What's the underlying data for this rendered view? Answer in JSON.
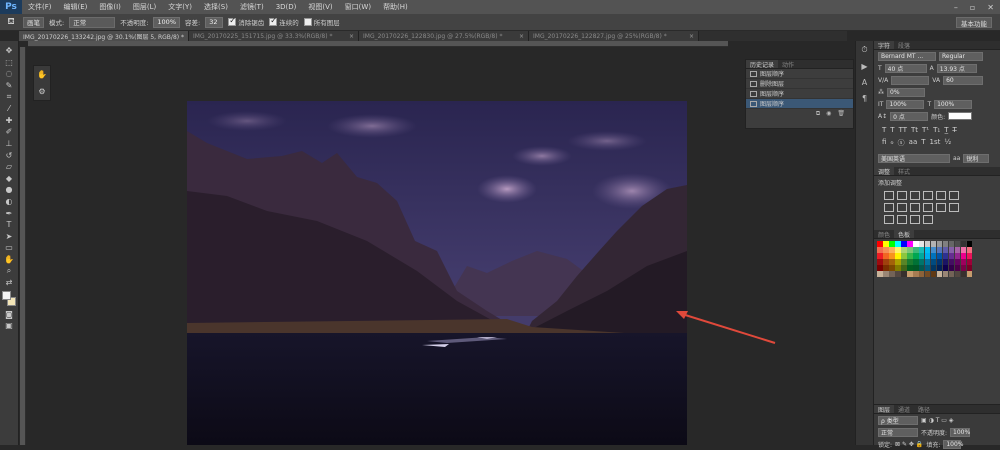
{
  "app": {
    "logo": "Ps"
  },
  "menu": [
    "文件(F)",
    "编辑(E)",
    "图像(I)",
    "图层(L)",
    "文字(Y)",
    "选择(S)",
    "滤镜(T)",
    "3D(D)",
    "视图(V)",
    "窗口(W)",
    "帮助(H)"
  ],
  "options": {
    "mode_value": "正常",
    "mode_label": "模式:",
    "preset_value": "画笔",
    "opacity_label": "不透明度:",
    "opacity_value": "100%",
    "tolerance_label": "容差:",
    "tolerance_value": "32",
    "antialias_label": "消除锯齿",
    "contiguous_label": "连续的",
    "all_layers_label": "所有图层",
    "workspace": "基本功能"
  },
  "doc_tabs": [
    {
      "label": "IMG_20170226_133242.jpg @ 30.1%(图层 5, RGB/8) *"
    },
    {
      "label": "IMG_20170225_151715.jpg @ 33.3%(RGB/8) *"
    },
    {
      "label": "IMG_20170226_122830.jpg @ 27.5%(RGB/8) *"
    },
    {
      "label": "IMG_20170226_122827.jpg @ 25%(RGB/8) *"
    }
  ],
  "history_panel": {
    "tabs": [
      "历史记录",
      "动作"
    ],
    "items": [
      "图层顺序",
      "删除图层",
      "图层顺序",
      "图层顺序"
    ]
  },
  "character_panel": {
    "tabs": [
      "字符",
      "段落"
    ],
    "font_family": "Bernard MT ...",
    "font_style": "Regular",
    "font_size": "40 点",
    "leading": "13.93 点",
    "kerning": "",
    "tracking": "60",
    "scale_pct": "0%",
    "vertical_scale": "100%",
    "horizontal_scale": "100%",
    "baseline": "0 点",
    "color_label": "颜色:",
    "language": "美国英语",
    "antialias": "锐利"
  },
  "adjust_panel": {
    "tabs": [
      "调整",
      "样式"
    ],
    "title": "添加调整"
  },
  "swatches_panel": {
    "tabs": [
      "颜色",
      "色板"
    ]
  },
  "layers_panel": {
    "tabs": [
      "图层",
      "通道",
      "路径"
    ],
    "kind": "ρ 类型",
    "blend": "正常",
    "opacity_label": "不透明度:",
    "opacity": "100%",
    "lock_label": "锁定:",
    "fill_label": "填充:",
    "fill": "100%"
  },
  "colors": {
    "accent": "#3b5876",
    "arrow": "#e0493b"
  }
}
